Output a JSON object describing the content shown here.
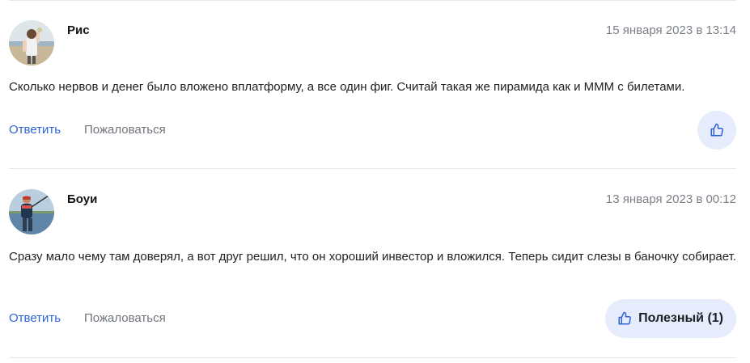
{
  "comments": [
    {
      "author": "Рис",
      "date": "15 января 2023 в 13:14",
      "text": "Сколько нервов и денег было вложено вплатформу, а все один фиг. Считай такая же пирамида как и МММ с билетами.",
      "reply_label": "Ответить",
      "report_label": "Пожаловаться",
      "like_label": ""
    },
    {
      "author": "Боуи",
      "date": "13 января 2023 в 00:12",
      "text": "Сразу мало чему там доверял, а вот друг решил, что он хороший инвестор и вложился. Теперь сидит слезы в баночку собирает.",
      "reply_label": "Ответить",
      "report_label": "Пожаловаться",
      "like_label": "Полезный (1)"
    }
  ],
  "colors": {
    "link": "#2c64d6",
    "like_bg": "#e6ecfb",
    "divider": "#e3e8ef"
  },
  "icons": {
    "like": "thumbs-up-icon"
  }
}
